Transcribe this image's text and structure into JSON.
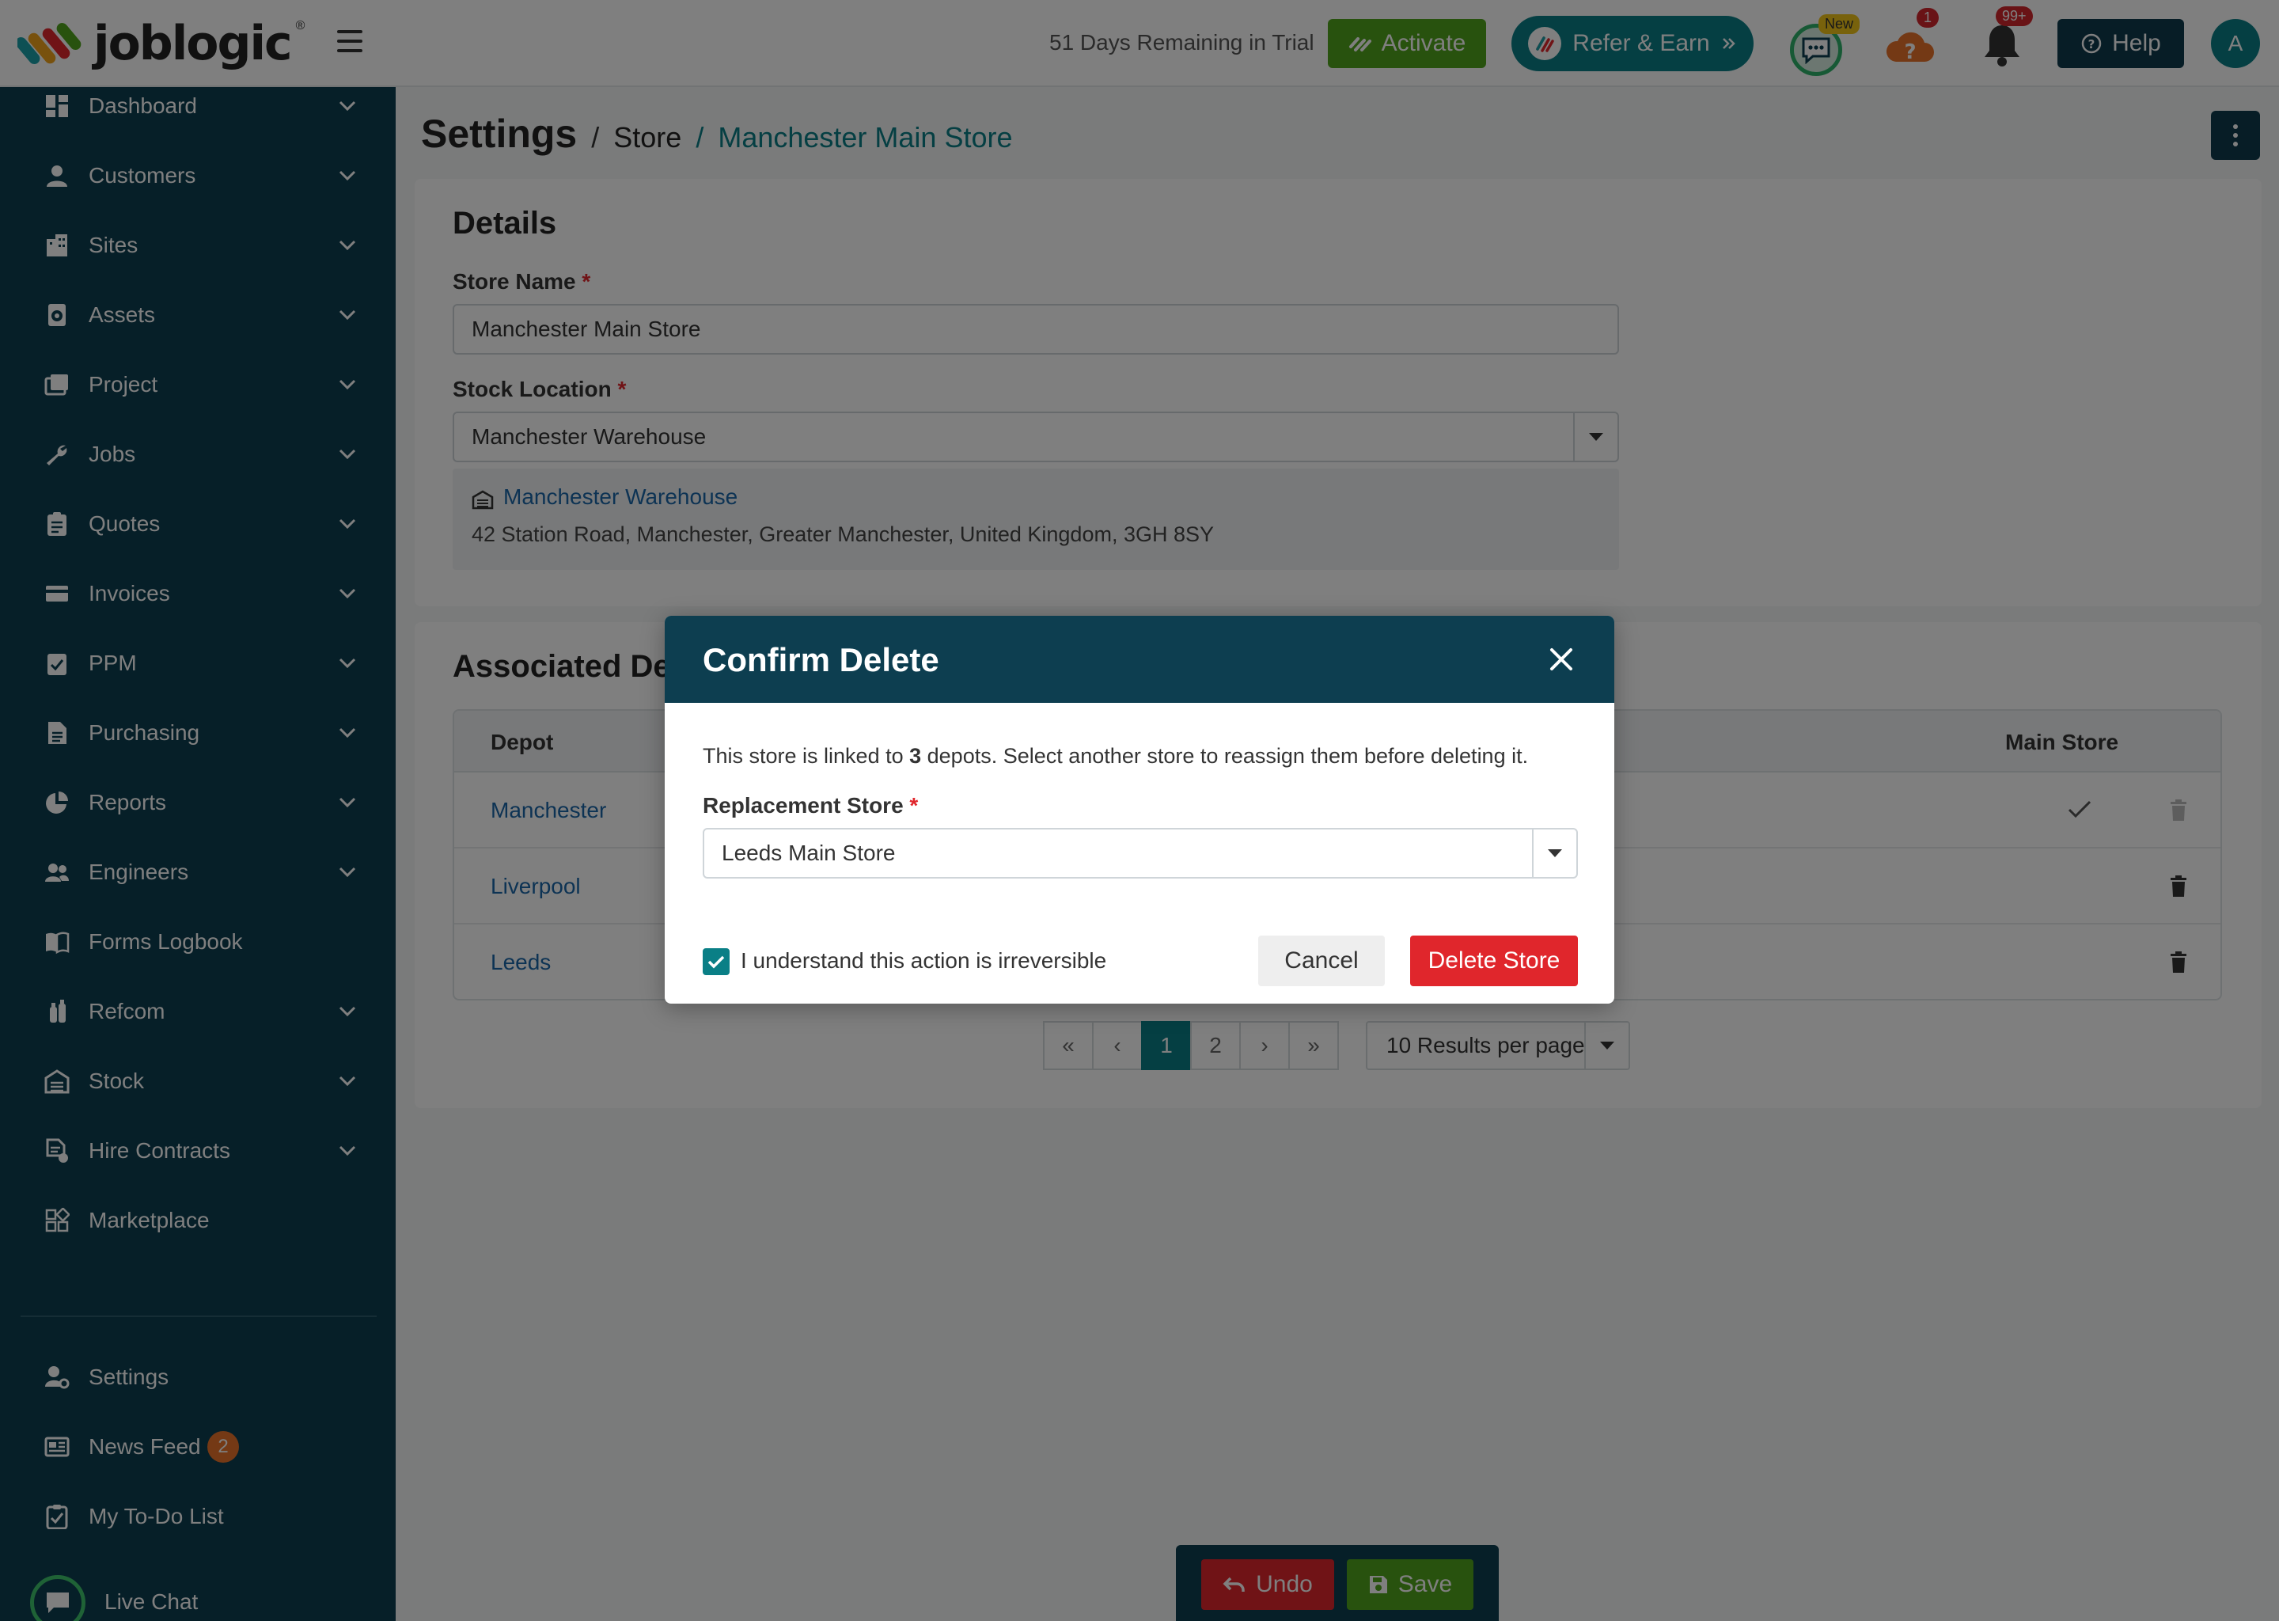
{
  "brand": {
    "name": "joblogic",
    "reg_mark": "®"
  },
  "topbar": {
    "trial_text": "51 Days Remaining in Trial",
    "activate_label": "Activate",
    "refer_label": "Refer & Earn",
    "chat_badge": "New",
    "help_badge": "1",
    "notif_badge": "99+",
    "help_label": "Help",
    "avatar_initial": "A"
  },
  "sidebar": {
    "items": [
      {
        "label": "Dashboard",
        "icon": "dashboard-icon",
        "has_chevron": true
      },
      {
        "label": "Customers",
        "icon": "person-icon",
        "has_chevron": true
      },
      {
        "label": "Sites",
        "icon": "building-icon",
        "has_chevron": true
      },
      {
        "label": "Assets",
        "icon": "asset-icon",
        "has_chevron": true
      },
      {
        "label": "Project",
        "icon": "project-icon",
        "has_chevron": true
      },
      {
        "label": "Jobs",
        "icon": "wrench-icon",
        "has_chevron": true
      },
      {
        "label": "Quotes",
        "icon": "clipboard-icon",
        "has_chevron": true
      },
      {
        "label": "Invoices",
        "icon": "card-icon",
        "has_chevron": true
      },
      {
        "label": "PPM",
        "icon": "checklist-icon",
        "has_chevron": true
      },
      {
        "label": "Purchasing",
        "icon": "document-icon",
        "has_chevron": true
      },
      {
        "label": "Reports",
        "icon": "pie-chart-icon",
        "has_chevron": true
      },
      {
        "label": "Engineers",
        "icon": "people-icon",
        "has_chevron": true
      },
      {
        "label": "Forms Logbook",
        "icon": "book-icon",
        "has_chevron": false
      },
      {
        "label": "Refcom",
        "icon": "cylinder-icon",
        "has_chevron": true
      },
      {
        "label": "Stock",
        "icon": "warehouse-icon",
        "has_chevron": true
      },
      {
        "label": "Hire Contracts",
        "icon": "contract-icon",
        "has_chevron": true
      },
      {
        "label": "Marketplace",
        "icon": "grid-icon",
        "has_chevron": false
      }
    ],
    "bottom_items": [
      {
        "label": "Settings",
        "icon": "user-gear-icon"
      },
      {
        "label": "News Feed",
        "icon": "newspaper-icon",
        "badge": "2"
      },
      {
        "label": "My To-Do List",
        "icon": "todo-icon"
      }
    ],
    "live_chat_label": "Live Chat"
  },
  "breadcrumb": {
    "title": "Settings",
    "sep": "/",
    "store": "Store",
    "current": "Manchester Main Store"
  },
  "details": {
    "title": "Details",
    "store_name_label": "Store Name",
    "store_name_value": "Manchester Main Store",
    "stock_location_label": "Stock Location",
    "stock_location_value": "Manchester Warehouse",
    "warehouse_name": "Manchester Warehouse",
    "warehouse_address": "42 Station Road, Manchester, Greater Manchester, United Kingdom, 3GH 8SY",
    "required_mark": "*"
  },
  "associated": {
    "title": "Associated Depots",
    "col_depot": "Depot",
    "col_main": "Main Store",
    "rows": [
      {
        "depot": "Manchester",
        "main": true
      },
      {
        "depot": "Liverpool",
        "main": false
      },
      {
        "depot": "Leeds",
        "main": false
      }
    ]
  },
  "pagination": {
    "first": "«",
    "prev": "‹",
    "pages": [
      "1",
      "2"
    ],
    "active_page": "1",
    "next": "›",
    "last": "»",
    "per_page": "10 Results per page"
  },
  "bottom_bar": {
    "undo_label": "Undo",
    "save_label": "Save"
  },
  "modal": {
    "title": "Confirm Delete",
    "msg_before": "This store is linked to ",
    "msg_count": "3",
    "msg_after": " depots. Select another store to reassign them before deleting it.",
    "replacement_label": "Replacement Store",
    "replacement_value": "Leeds Main Store",
    "checkbox_label": "I understand this action is irreversible",
    "checkbox_checked": true,
    "cancel_label": "Cancel",
    "delete_label": "Delete Store"
  },
  "colors": {
    "sidebar_bg": "#0d3e50",
    "accent_teal": "#0a7f86",
    "danger": "#e0262c",
    "success": "#51a51c"
  }
}
